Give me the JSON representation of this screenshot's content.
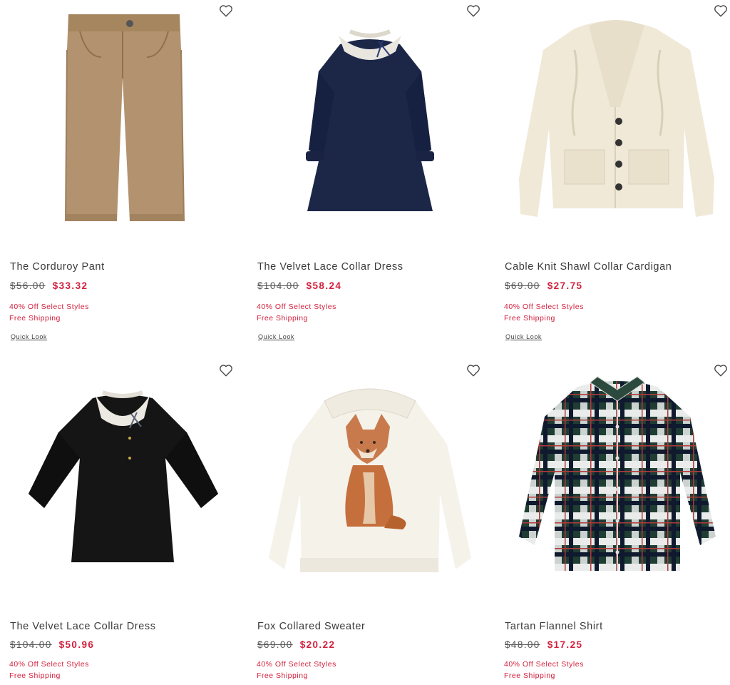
{
  "products": [
    {
      "name": "The Corduroy Pant",
      "original_price": "$56.00",
      "sale_price": "$33.32",
      "promo": "40% Off Select Styles",
      "shipping": "Free Shipping",
      "quick_look": "Quick Look",
      "image_icon": "corduroy-pant-image"
    },
    {
      "name": "The Velvet Lace Collar Dress",
      "original_price": "$104.00",
      "sale_price": "$58.24",
      "promo": "40% Off Select Styles",
      "shipping": "Free Shipping",
      "quick_look": "Quick Look",
      "image_icon": "navy-velvet-dress-image"
    },
    {
      "name": "Cable Knit Shawl Collar Cardigan",
      "original_price": "$69.00",
      "sale_price": "$27.75",
      "promo": "40% Off Select Styles",
      "shipping": "Free Shipping",
      "quick_look": "Quick Look",
      "image_icon": "cable-knit-cardigan-image"
    },
    {
      "name": "The Velvet Lace Collar Dress",
      "original_price": "$104.00",
      "sale_price": "$50.96",
      "promo": "40% Off Select Styles",
      "shipping": "Free Shipping",
      "image_icon": "black-velvet-dress-image"
    },
    {
      "name": "Fox Collared Sweater",
      "original_price": "$69.00",
      "sale_price": "$20.22",
      "promo": "40% Off Select Styles",
      "shipping": "Free Shipping",
      "image_icon": "fox-sweater-image"
    },
    {
      "name": "Tartan Flannel Shirt",
      "original_price": "$48.00",
      "sale_price": "$17.25",
      "promo": "40% Off Select Styles",
      "shipping": "Free Shipping",
      "image_icon": "tartan-shirt-image"
    }
  ],
  "icons": {
    "favorite": "heart-outline-icon"
  },
  "colors": {
    "sale": "#d21f3c",
    "text": "#3a3a3a",
    "background": "#ffffff"
  }
}
